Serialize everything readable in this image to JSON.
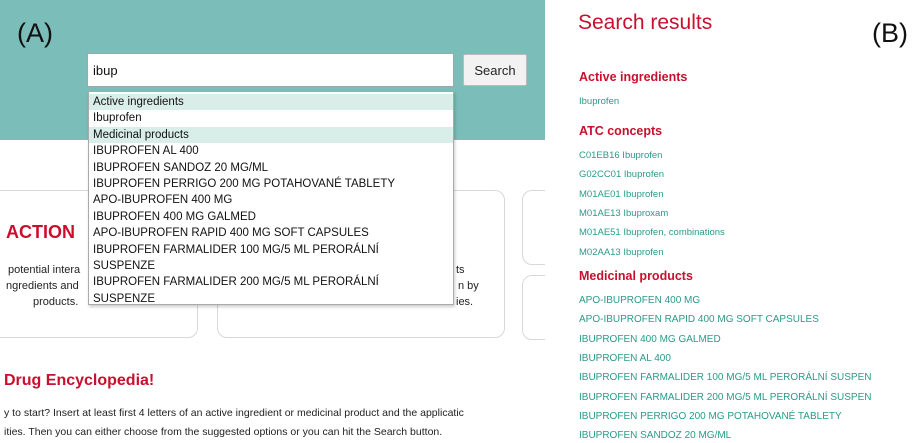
{
  "panel_a": {
    "label": "(A)",
    "search": {
      "value": "ibup",
      "button_label": "Search"
    },
    "dropdown": [
      {
        "text": "Active ingredients",
        "header": true
      },
      {
        "text": "Ibuprofen",
        "header": false
      },
      {
        "text": "Medicinal products",
        "header": true
      },
      {
        "text": "IBUPROFEN AL 400",
        "header": false
      },
      {
        "text": "IBUPROFEN SANDOZ 20 MG/ML",
        "header": false
      },
      {
        "text": "IBUPROFEN PERRIGO 200 MG POTAHOVANÉ TABLETY",
        "header": false
      },
      {
        "text": "APO-IBUPROFEN 400 MG",
        "header": false
      },
      {
        "text": "IBUPROFEN 400 MG GALMED",
        "header": false
      },
      {
        "text": "APO-IBUPROFEN RAPID 400 MG SOFT CAPSULES",
        "header": false
      },
      {
        "text": "IBUPROFEN FARMALIDER 100 MG/5 ML PERORÁLNÍ",
        "header": false
      },
      {
        "text": "SUSPENZE",
        "header": false
      },
      {
        "text": "IBUPROFEN FARMALIDER 200 MG/5 ML PERORÁLNÍ",
        "header": false
      },
      {
        "text": "SUSPENZE",
        "header": false
      }
    ],
    "background": {
      "interaction_title": "ACTION",
      "card_left_lines": [
        "potential intera",
        "ngredients and",
        "products."
      ],
      "card_right_lines": [
        "ts",
        "n by",
        "ies."
      ],
      "encyclopedia_title": "Drug Encyclopedia!",
      "encyclopedia_line1": "y to start? Insert at least first 4 letters of an active ingredient or medicinal product and the applicatic",
      "encyclopedia_line2": "ities. Then you can either choose from the suggested options or you can hit the Search button."
    }
  },
  "panel_b": {
    "label": "(B)",
    "title": "Search results",
    "sections": [
      {
        "heading": "Active ingredients",
        "items": [
          "Ibuprofen"
        ]
      },
      {
        "heading": "ATC concepts",
        "items": [
          "C01EB16 Ibuprofen",
          "G02CC01 Ibuprofen",
          "M01AE01 Ibuprofen",
          "M01AE13 Ibuproxam",
          "M01AE51 Ibuprofen, combinations",
          "M02AA13 Ibuprofen"
        ]
      },
      {
        "heading": "Medicinal products",
        "items": [
          "APO-IBUPROFEN 400 MG",
          "APO-IBUPROFEN RAPID 400 MG SOFT CAPSULES",
          "IBUPROFEN 400 MG GALMED",
          "IBUPROFEN AL 400",
          "IBUPROFEN FARMALIDER 100 MG/5 ML PERORÁLNÍ SUSPEN",
          "IBUPROFEN FARMALIDER 200 MG/5 ML PERORÁLNÍ SUSPEN",
          "IBUPROFEN PERRIGO 200 MG POTAHOVANÉ TABLETY",
          "IBUPROFEN SANDOZ 20 MG/ML"
        ]
      }
    ]
  },
  "colors": {
    "hero": "#7bbdb8",
    "heading_red": "#c8102e",
    "link_teal": "#2a9a8a",
    "dropdown_header": "#d9eee9"
  }
}
